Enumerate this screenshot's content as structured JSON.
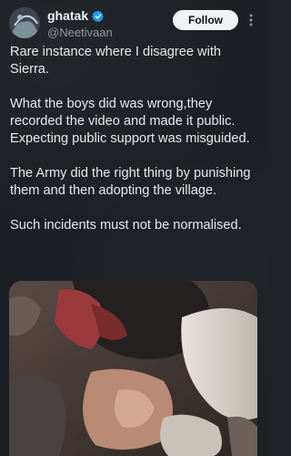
{
  "post": {
    "author": {
      "display_name": "ghatak",
      "handle": "@Neetivaan",
      "verified": true
    },
    "follow_label": "Follow",
    "more_icon": "more-vertical-icon",
    "paragraphs": [
      "Rare instance where I disagree with Sierra.",
      "What the boys did was wrong,they recorded the video and made it public. Expecting public support was misguided.",
      "The Army did the right thing by punishing them and then adopting the village.",
      "Such incidents must not be normalised."
    ]
  },
  "colors": {
    "background": "#1c2024",
    "text": "#e7e9ea",
    "secondary_text": "#8b98a5",
    "verified_badge": "#1d9bf0",
    "follow_button_bg": "#eff3f4"
  }
}
